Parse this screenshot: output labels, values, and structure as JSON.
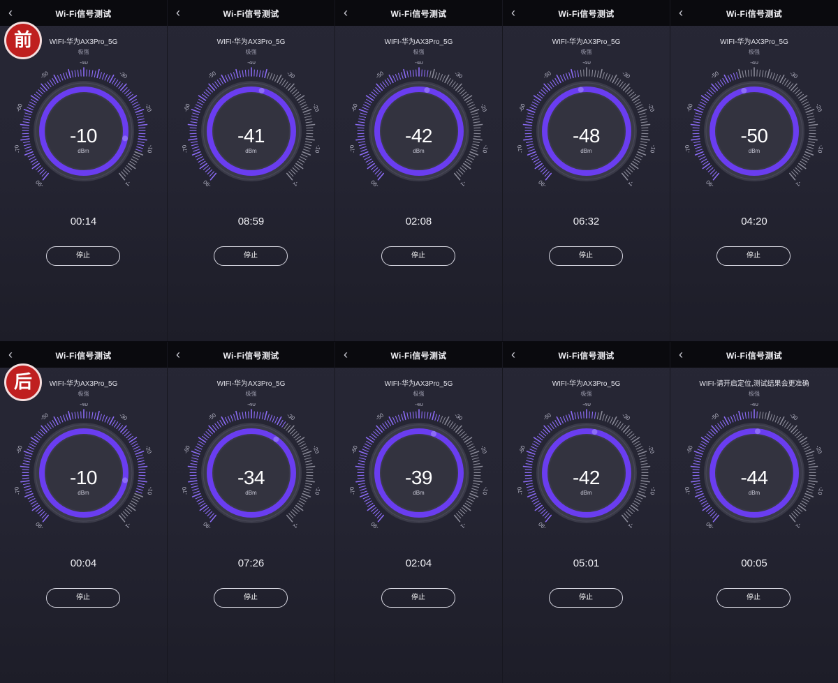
{
  "colors": {
    "accent": "#6a3df0",
    "accent_light": "#8c6cf7",
    "badge_red": "#bf1f1f",
    "background": "#252533"
  },
  "icons": {
    "back": "chevron-left-icon"
  },
  "scale_labels": [
    "-90",
    "-70",
    "-60",
    "-50",
    "-40",
    "-30",
    "-20",
    "-10",
    "-1"
  ],
  "rows": [
    {
      "badge": "前",
      "panels": [
        {
          "title": "Wi-Fi信号测试",
          "ssid": "WIFI-华为AX3Pro_5G",
          "quality": "极强",
          "value": -10,
          "value_text": "-10",
          "unit": "dBm",
          "time": "00:14",
          "stop": "停止"
        },
        {
          "title": "Wi-Fi信号测试",
          "ssid": "WIFI-华为AX3Pro_5G",
          "quality": "极强",
          "value": -41,
          "value_text": "-41",
          "unit": "dBm",
          "time": "08:59",
          "stop": "停止"
        },
        {
          "title": "Wi-Fi信号测试",
          "ssid": "WIFI-华为AX3Pro_5G",
          "quality": "极强",
          "value": -42,
          "value_text": "-42",
          "unit": "dBm",
          "time": "02:08",
          "stop": "停止"
        },
        {
          "title": "Wi-Fi信号测试",
          "ssid": "WIFI-华为AX3Pro_5G",
          "quality": "极强",
          "value": -48,
          "value_text": "-48",
          "unit": "dBm",
          "time": "06:32",
          "stop": "停止"
        },
        {
          "title": "Wi-Fi信号测试",
          "ssid": "WIFI-华为AX3Pro_5G",
          "quality": "极强",
          "value": -50,
          "value_text": "-50",
          "unit": "dBm",
          "time": "04:20",
          "stop": "停止"
        }
      ]
    },
    {
      "badge": "后",
      "panels": [
        {
          "title": "Wi-Fi信号测试",
          "ssid": "WIFI-华为AX3Pro_5G",
          "quality": "极强",
          "value": -10,
          "value_text": "-10",
          "unit": "dBm",
          "time": "00:04",
          "stop": "停止"
        },
        {
          "title": "Wi-Fi信号测试",
          "ssid": "WIFI-华为AX3Pro_5G",
          "quality": "极强",
          "value": -34,
          "value_text": "-34",
          "unit": "dBm",
          "time": "07:26",
          "stop": "停止"
        },
        {
          "title": "Wi-Fi信号测试",
          "ssid": "WIFI-华为AX3Pro_5G",
          "quality": "极强",
          "value": -39,
          "value_text": "-39",
          "unit": "dBm",
          "time": "02:04",
          "stop": "停止"
        },
        {
          "title": "Wi-Fi信号测试",
          "ssid": "WIFI-华为AX3Pro_5G",
          "quality": "极强",
          "value": -42,
          "value_text": "-42",
          "unit": "dBm",
          "time": "05:01",
          "stop": "停止"
        },
        {
          "title": "Wi-Fi信号测试",
          "ssid": "WIFI-请开启定位,测试结果会更准确",
          "quality": "极强",
          "value": -44,
          "value_text": "-44",
          "unit": "dBm",
          "time": "00:05",
          "stop": "停止"
        }
      ]
    }
  ]
}
